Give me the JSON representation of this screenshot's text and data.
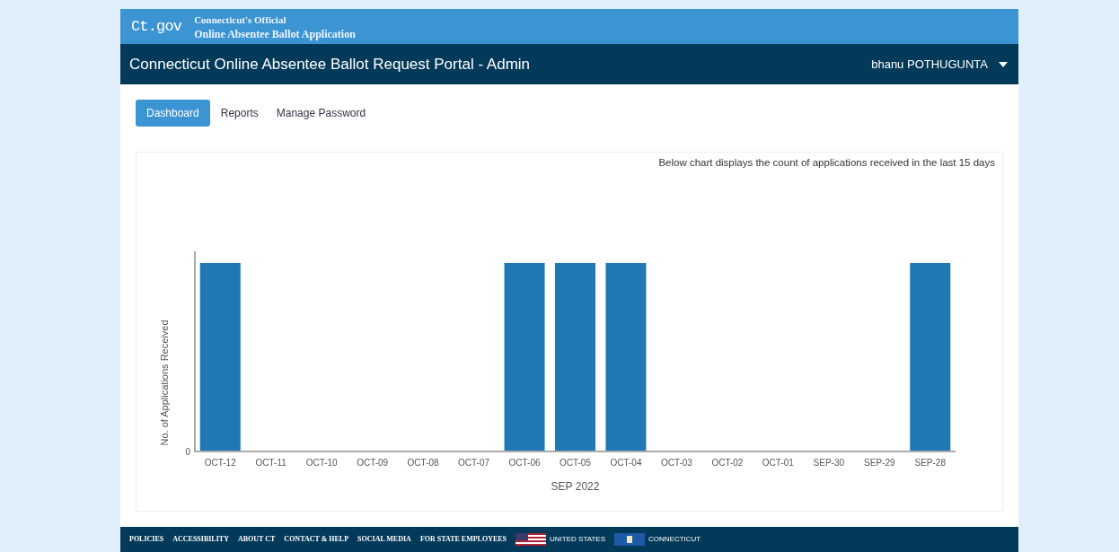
{
  "brand": {
    "logo": "Ct.gov",
    "line1": "Connecticut's Official",
    "line2": "Online Absentee Ballot Application"
  },
  "admin_bar": {
    "title": "Connecticut Online Absentee Ballot Request Portal - Admin",
    "user": "bhanu POTHUGUNTA"
  },
  "tabs": [
    {
      "label": "Dashboard",
      "selected": true
    },
    {
      "label": "Reports",
      "selected": false
    },
    {
      "label": "Manage Password",
      "selected": false
    }
  ],
  "chart_note": "Below chart displays the count of applications received in the last 15 days",
  "chart": {
    "xlabel": "SEP 2022",
    "ylabel": "No. of Applications Received",
    "y_tick": "0",
    "columns": [
      {
        "label": "OCT-12",
        "has_bar": true
      },
      {
        "label": "OCT-11",
        "has_bar": false
      },
      {
        "label": "OCT-10",
        "has_bar": false
      },
      {
        "label": "OCT-09",
        "has_bar": false
      },
      {
        "label": "OCT-08",
        "has_bar": false
      },
      {
        "label": "OCT-07",
        "has_bar": false
      },
      {
        "label": "OCT-06",
        "has_bar": true
      },
      {
        "label": "OCT-05",
        "has_bar": true
      },
      {
        "label": "OCT-04",
        "has_bar": true
      },
      {
        "label": "OCT-03",
        "has_bar": false
      },
      {
        "label": "OCT-02",
        "has_bar": false
      },
      {
        "label": "OCT-01",
        "has_bar": false
      },
      {
        "label": "SEP-30",
        "has_bar": false
      },
      {
        "label": "SEP-29",
        "has_bar": false
      },
      {
        "label": "SEP-28",
        "has_bar": true
      }
    ]
  },
  "footer": {
    "links": [
      "POLICIES",
      "ACCESSIBILITY",
      "ABOUT CT",
      "CONTACT & HELP",
      "SOCIAL MEDIA",
      "FOR STATE EMPLOYEES"
    ],
    "flags": [
      {
        "kind": "us",
        "label": "UNITED STATES"
      },
      {
        "kind": "ct",
        "label": "CONNECTICUT"
      }
    ]
  }
}
